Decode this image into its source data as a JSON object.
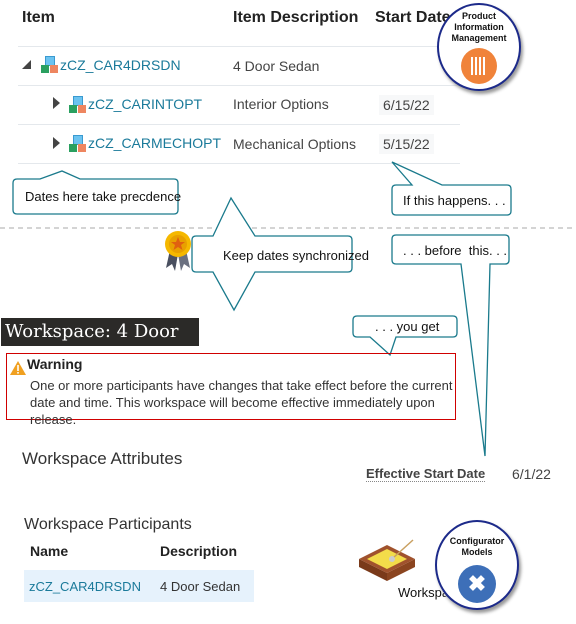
{
  "items_table": {
    "headers": {
      "item": "Item",
      "description": "Item Description",
      "start_date": "Start Date"
    },
    "rows": [
      {
        "item": "zCZ_CAR4DRSDN",
        "description": "4 Door Sedan",
        "start_date": "",
        "expanded": true
      },
      {
        "item": "zCZ_CARINTOPT",
        "description": "Interior Options",
        "start_date": "6/15/22",
        "expanded": false
      },
      {
        "item": "zCZ_CARMECHOPT",
        "description": "Mechanical Options",
        "start_date": "5/15/22",
        "expanded": false
      }
    ]
  },
  "badges": {
    "pim": "Product Information Management",
    "pim_line1": "Product",
    "pim_line2": "Information",
    "pim_line3": "Management",
    "configurator_line1": "Configurator",
    "configurator_line2": "Models",
    "workspace_label": "Workspace"
  },
  "callouts": {
    "precedence": "Dates here take precdence",
    "if_happens": "If this happens. . .",
    "sync": "Keep dates synchronized",
    "before_this": ". . . before  this. . .",
    "you_get": ". . . you get"
  },
  "workspace": {
    "title": "Workspace: 4 Door Sedan",
    "warning_title": "Warning",
    "warning_text": "One or more participants have changes that take effect before the current date and time. This workspace will become effective immediately upon release.",
    "attributes_heading": "Workspace Attributes",
    "effective_start_label": "Effective Start Date",
    "effective_start_value": "6/1/22",
    "participants_heading": "Workspace Participants",
    "participants_headers": {
      "name": "Name",
      "description": "Description"
    },
    "participants": [
      {
        "name": "zCZ_CAR4DRSDN",
        "description": "4 Door Sedan"
      }
    ]
  },
  "colors": {
    "callout_border": "#1a7a8c",
    "link": "#1a7a9a",
    "warning_border": "#d00000",
    "pim_orange": "#f0833a",
    "configurator_blue": "#3d6fb8"
  }
}
